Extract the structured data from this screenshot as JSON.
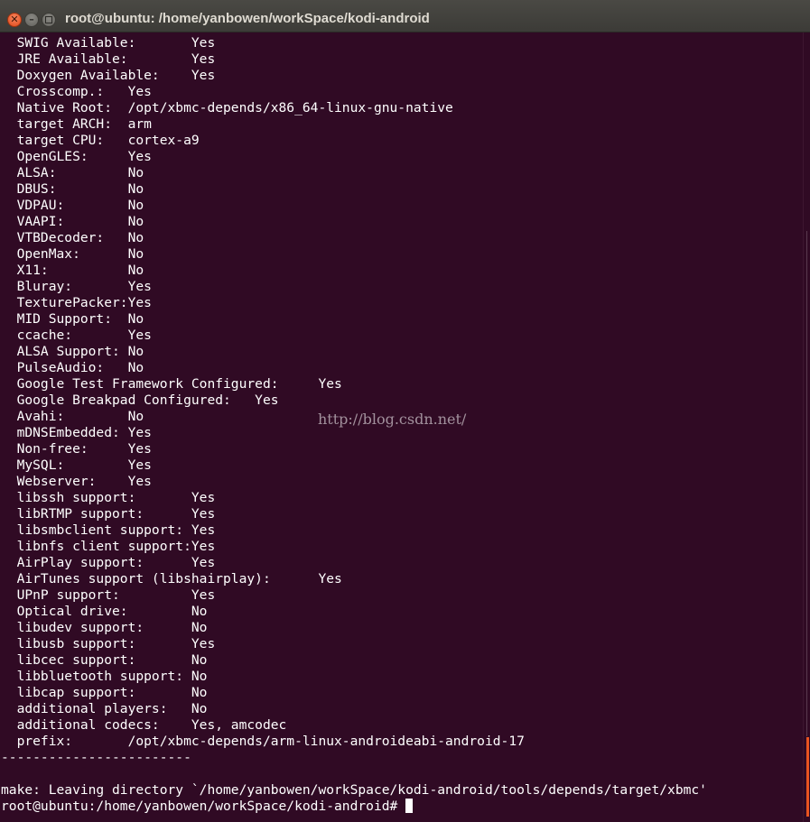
{
  "window": {
    "title": "root@ubuntu: /home/yanbowen/workSpace/kodi-android",
    "close_glyph": "✕",
    "minimize_glyph": "–"
  },
  "terminal": {
    "lines": [
      "  SWIG Available:       Yes",
      "  JRE Available:        Yes",
      "  Doxygen Available:    Yes",
      "  Crosscomp.:   Yes",
      "  Native Root:  /opt/xbmc-depends/x86_64-linux-gnu-native",
      "  target ARCH:  arm",
      "  target CPU:   cortex-a9",
      "  OpenGLES:     Yes",
      "  ALSA:         No",
      "  DBUS:         No",
      "  VDPAU:        No",
      "  VAAPI:        No",
      "  VTBDecoder:   No",
      "  OpenMax:      No",
      "  X11:          No",
      "  Bluray:       Yes",
      "  TexturePacker:Yes",
      "  MID Support:  No",
      "  ccache:       Yes",
      "  ALSA Support: No",
      "  PulseAudio:   No",
      "  Google Test Framework Configured:     Yes",
      "  Google Breakpad Configured:   Yes",
      "  Avahi:        No",
      "  mDNSEmbedded: Yes",
      "  Non-free:     Yes",
      "  MySQL:        Yes",
      "  Webserver:    Yes",
      "  libssh support:       Yes",
      "  libRTMP support:      Yes",
      "  libsmbclient support: Yes",
      "  libnfs client support:Yes",
      "  AirPlay support:      Yes",
      "  AirTunes support (libshairplay):      Yes",
      "  UPnP support:         Yes",
      "  Optical drive:        No",
      "  libudev support:      No",
      "  libusb support:       Yes",
      "  libcec support:       No",
      "  libbluetooth support: No",
      "  libcap support:       No",
      "  additional players:   No",
      "  additional codecs:    Yes, amcodec",
      "  prefix:       /opt/xbmc-depends/arm-linux-androideabi-android-17",
      "------------------------",
      "",
      "make: Leaving directory `/home/yanbowen/workSpace/kodi-android/tools/depends/target/xbmc'",
      "root@ubuntu:/home/yanbowen/workSpace/kodi-android#"
    ]
  },
  "watermark": "http://blog.csdn.net/",
  "colors": {
    "background": "#300a24",
    "foreground": "#ffffff",
    "titlebar": "#3c3b37",
    "close_button": "#e0491a",
    "scroll_thumb": "#e95420"
  }
}
